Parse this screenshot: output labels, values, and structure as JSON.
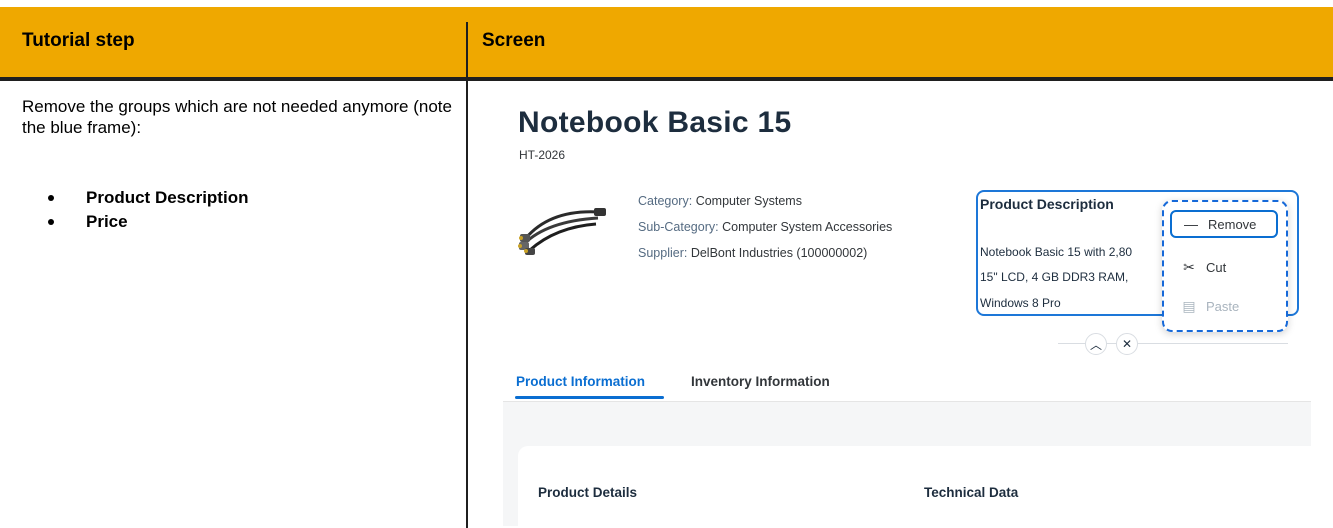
{
  "table": {
    "header": {
      "col1": "Tutorial step",
      "col2": "Screen"
    },
    "step": {
      "intro": "Remove the groups which are not needed anymore (note the blue frame):",
      "items": [
        "Product Description",
        "Price"
      ]
    }
  },
  "screen": {
    "product": {
      "title": "Notebook Basic 15",
      "id": "HT-2026",
      "category_label": "Category:",
      "category_value": "Computer Systems",
      "subcategory_label": "Sub-Category:",
      "subcategory_value": "Computer System Accessories",
      "supplier_label": "Supplier:",
      "supplier_value": "DelBont Industries (100000002)"
    },
    "description_group": {
      "title": "Product Description",
      "lines": [
        "Notebook Basic 15 with 2,80",
        "15\" LCD, 4 GB DDR3 RAM,",
        "Windows 8 Pro"
      ]
    },
    "context_menu": {
      "remove": "Remove",
      "cut": "Cut",
      "paste": "Paste"
    },
    "tabs": [
      "Product Information",
      "Inventory Information"
    ],
    "sections": [
      "Product Details",
      "Technical Data"
    ],
    "colors": {
      "accent": "#0a6ed1",
      "header": "#efa800",
      "frame": "#1d77d8"
    }
  }
}
